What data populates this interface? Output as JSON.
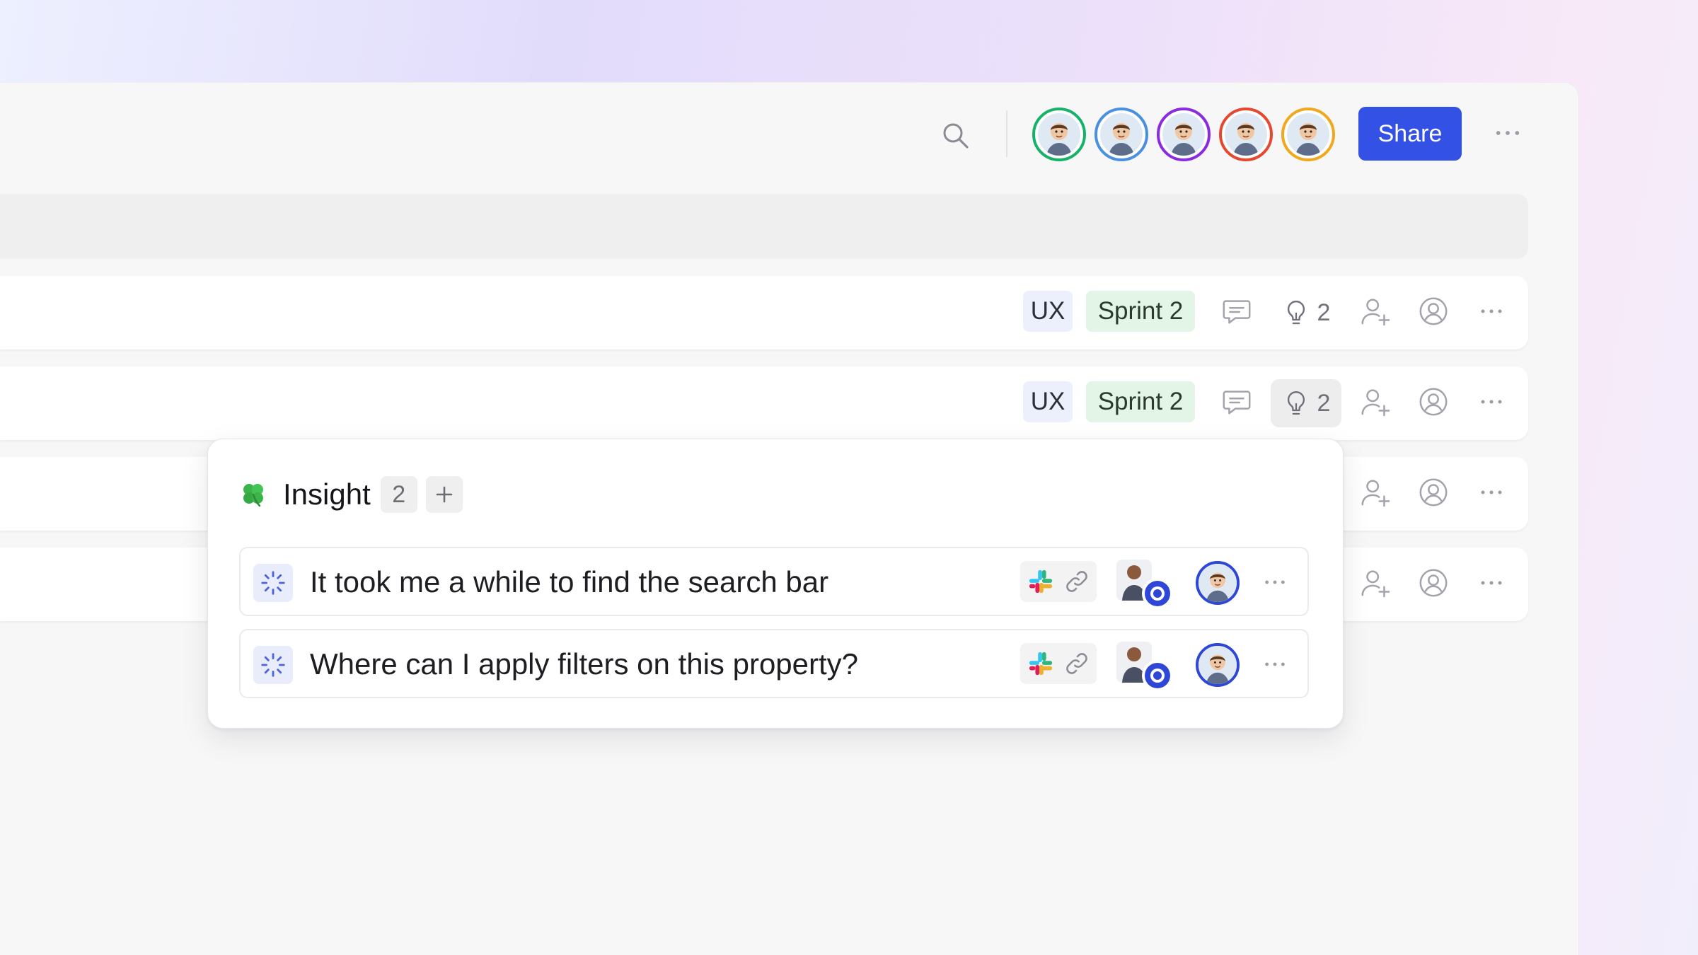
{
  "header": {
    "share_label": "Share",
    "avatar_colors": [
      "#17b26a",
      "#4a90e2",
      "#8a2be2",
      "#e5482f",
      "#f0a81f"
    ]
  },
  "rows": [
    {
      "tag_ux": "UX",
      "tag_sprint": "Sprint 2",
      "insight_count": "2"
    },
    {
      "tag_ux": "UX",
      "tag_sprint": "Sprint 2",
      "insight_count": "2"
    },
    {},
    {}
  ],
  "insight_popover": {
    "title": "Insight",
    "count": "2",
    "items": [
      {
        "text": "It took me a while to find the search bar"
      },
      {
        "text": "Where can I apply filters on this property?"
      }
    ]
  },
  "colors": {
    "accent": "#3451e6",
    "tag_ux_bg": "#ebf0fc",
    "tag_sprint_bg": "#e3f5e6"
  },
  "icons": [
    "search-icon",
    "more-horizontal-icon",
    "comment-icon",
    "lightbulb-icon",
    "add-person-icon",
    "user-circle-icon",
    "clover-icon",
    "plus-icon",
    "loading-status-icon",
    "slack-icon",
    "link-icon"
  ]
}
